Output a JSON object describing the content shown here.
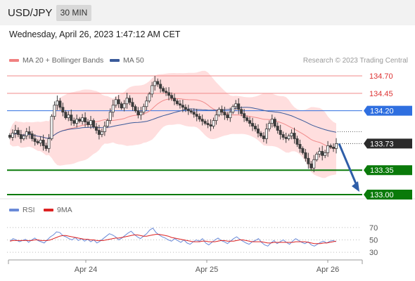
{
  "header": {
    "symbol": "USD/JPY",
    "timeframe": "30 MIN"
  },
  "datetime": "Wednesday, April 26, 2023 1:47:12 AM CET",
  "legend": {
    "bb_label": "MA 20 + Bollinger Bands",
    "ma50_label": "MA 50",
    "credit": "Research © 2023 Trading Central"
  },
  "rsi_legend": {
    "rsi_label": "RSI",
    "ma_label": "9MA"
  },
  "colors": {
    "bb_band": "#ffdede",
    "bb_swatch": "#f08080",
    "ma20": "#f08a8a",
    "ma50": "#3a5a9a",
    "candle": "#3c3c3c",
    "line_red": "#f08a8a",
    "line_blue": "#2f6fe0",
    "line_green": "#0a7a0a",
    "current_box": "#2b2b2b",
    "arrow": "#2f5ea8",
    "rsi": "#6a8ad8",
    "rsi_ma": "#dd2222"
  },
  "chart_data": {
    "type": "candlestick",
    "x_ticks": [
      "Apr 24",
      "Apr 25",
      "Apr 26"
    ],
    "ylim": [
      132.95,
      134.78
    ],
    "last_price": "133.73",
    "current_price_line": 133.73,
    "forecast_target": 133.0,
    "levels": [
      {
        "label": "134.70",
        "value": 134.7,
        "kind": "resistance"
      },
      {
        "label": "134.45",
        "value": 134.45,
        "kind": "resistance"
      },
      {
        "label": "134.20",
        "value": 134.2,
        "kind": "pivot"
      },
      {
        "label": "133.35",
        "value": 133.35,
        "kind": "support"
      },
      {
        "label": "133.00",
        "value": 133.0,
        "kind": "support"
      }
    ],
    "candles_close": [
      133.82,
      133.88,
      133.92,
      133.86,
      133.8,
      133.84,
      133.9,
      133.87,
      133.8,
      133.76,
      133.74,
      133.78,
      133.7,
      133.66,
      133.8,
      134.12,
      134.28,
      134.34,
      134.25,
      134.18,
      134.1,
      134.14,
      134.06,
      134.02,
      134.08,
      134.05,
      134.1,
      134.04,
      134.0,
      134.06,
      133.97,
      133.92,
      133.86,
      133.9,
      133.98,
      134.06,
      134.18,
      134.28,
      134.36,
      134.3,
      134.24,
      134.3,
      134.38,
      134.32,
      134.26,
      134.2,
      134.14,
      134.18,
      134.26,
      134.34,
      134.44,
      134.56,
      134.62,
      134.58,
      134.52,
      134.48,
      134.46,
      134.42,
      134.38,
      134.34,
      134.3,
      134.28,
      134.25,
      134.22,
      134.2,
      134.18,
      134.15,
      134.12,
      134.08,
      134.05,
      134.02,
      134.0,
      133.98,
      134.06,
      134.14,
      134.22,
      134.18,
      134.14,
      134.1,
      134.18,
      134.26,
      134.3,
      134.22,
      134.16,
      134.1,
      134.06,
      134.02,
      133.98,
      133.94,
      133.88,
      133.84,
      133.8,
      133.94,
      134.02,
      134.08,
      133.98,
      133.92,
      133.86,
      133.82,
      133.8,
      133.84,
      133.88,
      133.8,
      133.72,
      133.66,
      133.6,
      133.52,
      133.44,
      133.38,
      133.5,
      133.58,
      133.62,
      133.56,
      133.6,
      133.7,
      133.68,
      133.66,
      133.73
    ],
    "rsi_ticks": [
      70,
      50,
      30
    ],
    "rsi_ylim": [
      20,
      80
    ],
    "rsi_values": [
      48,
      52,
      50,
      47,
      49,
      51,
      46,
      50,
      53,
      49,
      47,
      45,
      50,
      55,
      58,
      63,
      62,
      57,
      55,
      52,
      50,
      54,
      49,
      52,
      48,
      51,
      47,
      50,
      45,
      48,
      52,
      56,
      60,
      58,
      55,
      50,
      53,
      57,
      61,
      64,
      59,
      55,
      52,
      56,
      60,
      66,
      69,
      62,
      58,
      55,
      53,
      50,
      48,
      52,
      49,
      46,
      50,
      45,
      43,
      47,
      50,
      48,
      52,
      45,
      42,
      46,
      50,
      53,
      49,
      47,
      44,
      48,
      52,
      55,
      51,
      48,
      45,
      43,
      47,
      49,
      52,
      46,
      42,
      40,
      45,
      49,
      44,
      47,
      50,
      46,
      43,
      48,
      52,
      49,
      46,
      44,
      47,
      42,
      40,
      43,
      46,
      48,
      45,
      48,
      49,
      47
    ],
    "rsi_ma_values": [
      48,
      49,
      49,
      49,
      49,
      49,
      49,
      49,
      50,
      50,
      49,
      49,
      49,
      50,
      52,
      54,
      56,
      57,
      57,
      56,
      55,
      54,
      53,
      52,
      51,
      51,
      50,
      50,
      49,
      49,
      49,
      50,
      51,
      52,
      53,
      53,
      54,
      55,
      56,
      57,
      58,
      58,
      57,
      56,
      56,
      57,
      58,
      59,
      59,
      58,
      57,
      56,
      54,
      53,
      52,
      51,
      50,
      49,
      48,
      47,
      47,
      47,
      48,
      48,
      47,
      47,
      47,
      48,
      49,
      49,
      48,
      48,
      48,
      49,
      50,
      50,
      49,
      48,
      47,
      47,
      47,
      47,
      46,
      45,
      45,
      46,
      46,
      46,
      46,
      46,
      46,
      46,
      47,
      47,
      47,
      47,
      46,
      45,
      44,
      44,
      44,
      45,
      45,
      46,
      47,
      48
    ]
  }
}
